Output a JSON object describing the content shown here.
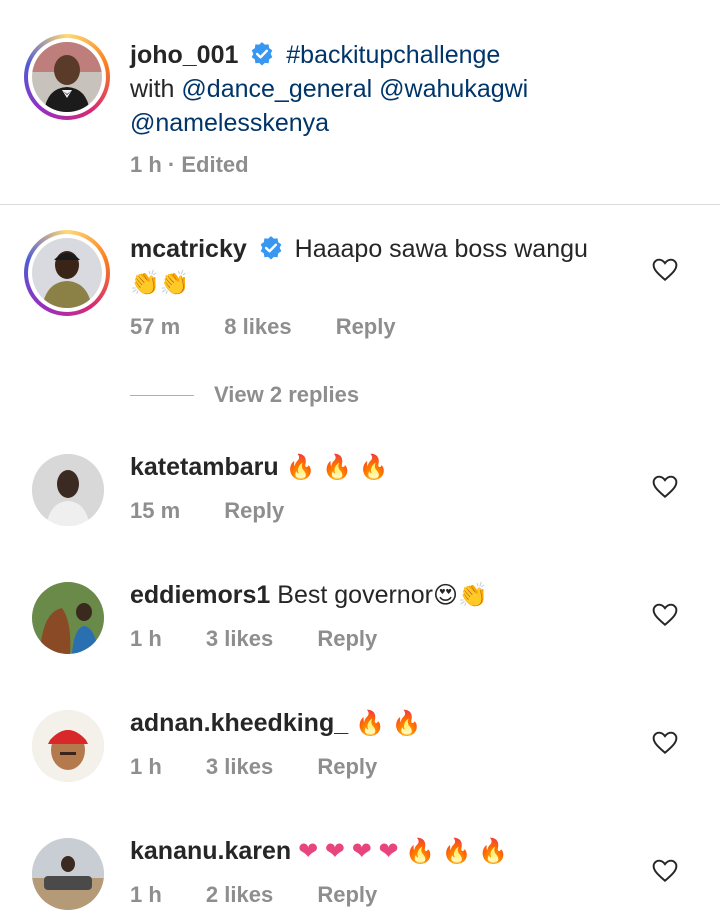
{
  "post": {
    "username": "joho_001",
    "caption_parts": [
      "#backitupchallenge",
      "with",
      "@dance_general",
      "@wahukagwi",
      "@namelesskenya"
    ],
    "time": "1 h",
    "edited": "· Edited"
  },
  "comments": [
    {
      "username": "mcatricky",
      "verified": true,
      "text": "Haaapo sawa boss wangu",
      "emoji": "👏👏",
      "time": "57 m",
      "likes": "8 likes",
      "reply": "Reply",
      "view_replies": "View 2 replies"
    },
    {
      "username": "katetambaru",
      "text": "",
      "emoji": "🔥 🔥 🔥",
      "time": "15 m",
      "likes": "",
      "reply": "Reply"
    },
    {
      "username": "eddiemors1",
      "text": "Best governor",
      "emoji": "😍👏",
      "time": "1 h",
      "likes": "3 likes",
      "reply": "Reply"
    },
    {
      "username": "adnan.kheedking_",
      "text": "",
      "emoji": "🔥 🔥",
      "time": "1 h",
      "likes": "3 likes",
      "reply": "Reply"
    },
    {
      "username": "kananu.karen",
      "text": "",
      "emoji": "❤ ❤ ❤ ❤ 🔥 🔥 🔥",
      "time": "1 h",
      "likes": "2 likes",
      "reply": "Reply"
    }
  ],
  "colors": {
    "link": "#003569",
    "verified": "#3897f0",
    "meta": "#8e8e8e",
    "heart_emoji": "#e8457e",
    "fire": "#f26522"
  }
}
